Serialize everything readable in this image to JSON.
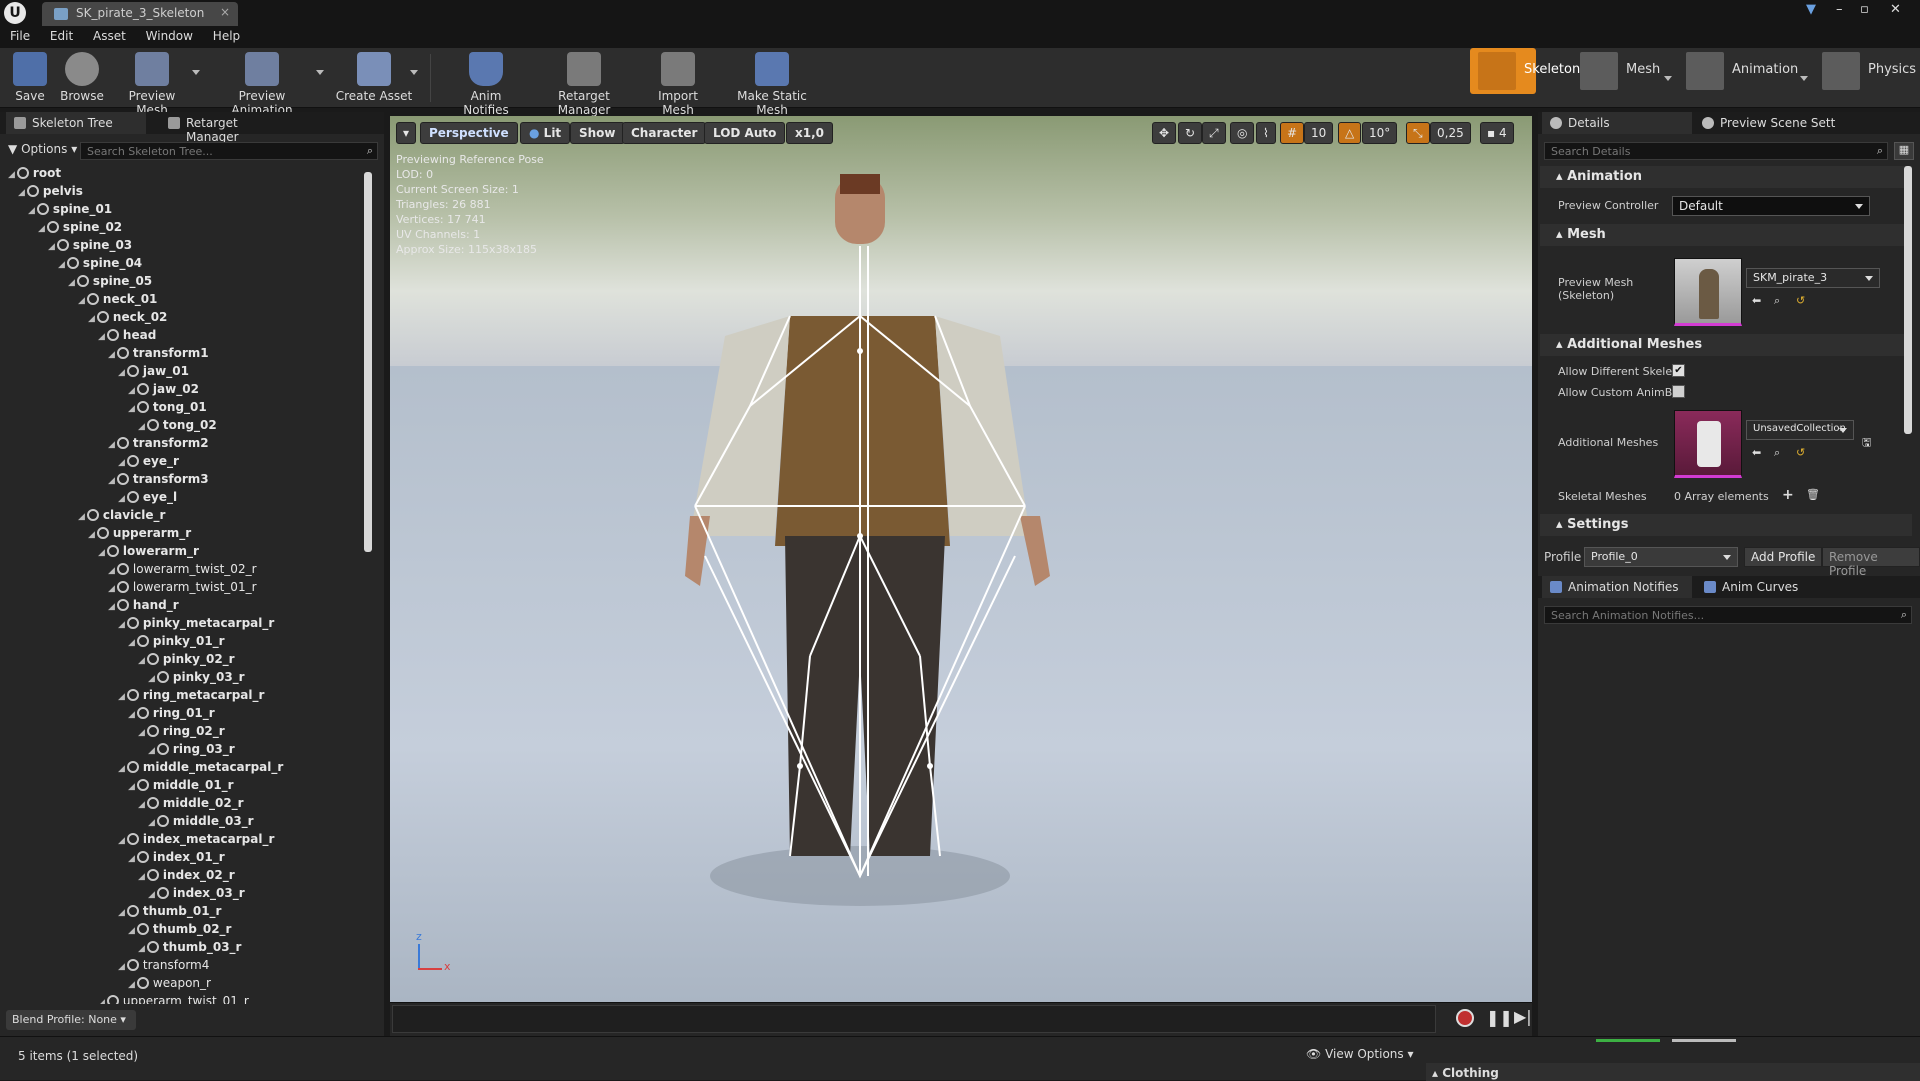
{
  "window": {
    "doc_tab": "SK_pirate_3_Skeleton",
    "close": "×",
    "controls": [
      "–",
      "▫",
      "✕"
    ]
  },
  "menu": [
    "File",
    "Edit",
    "Asset",
    "Window",
    "Help"
  ],
  "toolbar": {
    "buttons": [
      {
        "label": "Save",
        "icon": "save-icon"
      },
      {
        "label": "Browse",
        "icon": "browse-icon"
      },
      {
        "label": "Preview Mesh",
        "icon": "preview-mesh-icon"
      },
      {
        "label": "Preview Animation",
        "icon": "preview-animation-icon"
      },
      {
        "label": "Create Asset",
        "icon": "create-asset-icon"
      },
      {
        "label": "Anim Notifies",
        "icon": "anim-notifies-icon"
      },
      {
        "label": "Retarget Manager",
        "icon": "retarget-manager-icon"
      },
      {
        "label": "Import Mesh",
        "icon": "import-mesh-icon"
      },
      {
        "label": "Make Static Mesh",
        "icon": "make-static-mesh-icon"
      }
    ],
    "modes": [
      "Skeleton",
      "Mesh",
      "Animation",
      "Physics"
    ],
    "active_mode_color": "#e58a1e"
  },
  "left_panel": {
    "tabs": [
      "Skeleton Tree",
      "Retarget Manager"
    ],
    "options_label": "Options",
    "search_placeholder": "Search Skeleton Tree...",
    "bones": [
      {
        "name": "root",
        "depth": 0
      },
      {
        "name": "pelvis",
        "depth": 1
      },
      {
        "name": "spine_01",
        "depth": 2
      },
      {
        "name": "spine_02",
        "depth": 3
      },
      {
        "name": "spine_03",
        "depth": 4
      },
      {
        "name": "spine_04",
        "depth": 5
      },
      {
        "name": "spine_05",
        "depth": 6
      },
      {
        "name": "neck_01",
        "depth": 7
      },
      {
        "name": "neck_02",
        "depth": 8
      },
      {
        "name": "head",
        "depth": 9
      },
      {
        "name": "transform1",
        "depth": 10
      },
      {
        "name": "jaw_01",
        "depth": 11
      },
      {
        "name": "jaw_02",
        "depth": 12
      },
      {
        "name": "tong_01",
        "depth": 12
      },
      {
        "name": "tong_02",
        "depth": 13
      },
      {
        "name": "transform2",
        "depth": 10
      },
      {
        "name": "eye_r",
        "depth": 11
      },
      {
        "name": "transform3",
        "depth": 10
      },
      {
        "name": "eye_l",
        "depth": 11
      },
      {
        "name": "clavicle_r",
        "depth": 7
      },
      {
        "name": "upperarm_r",
        "depth": 8
      },
      {
        "name": "lowerarm_r",
        "depth": 9
      },
      {
        "name": "lowerarm_twist_02_r",
        "depth": 10
      },
      {
        "name": "lowerarm_twist_01_r",
        "depth": 10
      },
      {
        "name": "hand_r",
        "depth": 10
      },
      {
        "name": "pinky_metacarpal_r",
        "depth": 11
      },
      {
        "name": "pinky_01_r",
        "depth": 12
      },
      {
        "name": "pinky_02_r",
        "depth": 13
      },
      {
        "name": "pinky_03_r",
        "depth": 14
      },
      {
        "name": "ring_metacarpal_r",
        "depth": 11
      },
      {
        "name": "ring_01_r",
        "depth": 12
      },
      {
        "name": "ring_02_r",
        "depth": 13
      },
      {
        "name": "ring_03_r",
        "depth": 14
      },
      {
        "name": "middle_metacarpal_r",
        "depth": 11
      },
      {
        "name": "middle_01_r",
        "depth": 12
      },
      {
        "name": "middle_02_r",
        "depth": 13
      },
      {
        "name": "middle_03_r",
        "depth": 14
      },
      {
        "name": "index_metacarpal_r",
        "depth": 11
      },
      {
        "name": "index_01_r",
        "depth": 12
      },
      {
        "name": "index_02_r",
        "depth": 13
      },
      {
        "name": "index_03_r",
        "depth": 14
      },
      {
        "name": "thumb_01_r",
        "depth": 11
      },
      {
        "name": "thumb_02_r",
        "depth": 12
      },
      {
        "name": "thumb_03_r",
        "depth": 13
      },
      {
        "name": "transform4",
        "depth": 11
      },
      {
        "name": "weapon_r",
        "depth": 12
      },
      {
        "name": "upperarm_twist_01_r",
        "depth": 9
      }
    ],
    "blend_profile": "Blend Profile: None"
  },
  "viewport": {
    "buttons": [
      "Perspective",
      "Lit",
      "Show",
      "Character",
      "LOD Auto",
      "x1,0"
    ],
    "info": [
      "Previewing Reference Pose",
      "LOD: 0",
      "Current Screen Size: 1",
      "Triangles: 26 881",
      "Vertices: 17 741",
      "UV Channels: 1",
      "Approx Size: 115x38x185"
    ],
    "right_controls": {
      "grid": "10",
      "angle": "10°",
      "scale": "0,25",
      "camera_speed": "4"
    },
    "axis": {
      "z": "z",
      "x": "x"
    }
  },
  "details": {
    "tabs": [
      "Details",
      "Preview Scene Sett"
    ],
    "search_placeholder": "Search Details",
    "animation_section": "Animation",
    "preview_controller_label": "Preview Controller",
    "preview_controller_value": "Default",
    "mesh_section": "Mesh",
    "preview_mesh_label": "Preview Mesh (Skeleton)",
    "preview_mesh_value": "SKM_pirate_3",
    "additional_meshes_section": "Additional Meshes",
    "allow_different_label": "Allow Different Skelet",
    "allow_different_checked": true,
    "allow_custom_label": "Allow Custom AnimBl",
    "allow_custom_checked": false,
    "additional_meshes_label": "Additional Meshes",
    "additional_meshes_value": "UnsavedCollection",
    "skeletal_meshes_label": "Skeletal Meshes",
    "skeletal_meshes_value": "0 Array elements",
    "settings_section": "Settings",
    "profile_label": "Profile",
    "profile_value": "Profile_0",
    "add_profile": "Add Profile",
    "remove_profile": "Remove Profile"
  },
  "notifies": {
    "tabs": [
      "Animation Notifies",
      "Anim Curves"
    ],
    "search_placeholder": "Search Animation Notifies..."
  },
  "status": {
    "items": "5 items (1 selected)",
    "view_options": "View Options",
    "clothing": "Clothing"
  }
}
